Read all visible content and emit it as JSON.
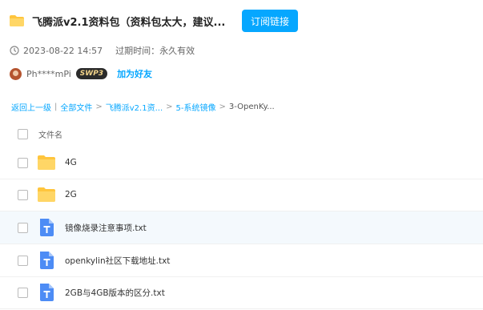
{
  "header": {
    "title": "飞腾派v2.1资料包（资料包太大，建议...",
    "subscribe_label": "订阅链接"
  },
  "meta": {
    "datetime": "2023-08-22 14:57",
    "expire": "过期时间：永久有效"
  },
  "user": {
    "name": "Ph****mPi",
    "badge": "SWP3",
    "add_friend": "加为好友"
  },
  "breadcrumb": {
    "back": "返回上一级",
    "all_files": "全部文件",
    "level1": "飞腾派v2.1资...",
    "level2": "5-系统镜像",
    "current": "3-OpenKy...",
    "sep": ">",
    "divider": "|"
  },
  "list": {
    "header": "文件名",
    "rows": [
      {
        "name": "4G",
        "icon": "folder-icon"
      },
      {
        "name": "2G",
        "icon": "folder-icon"
      },
      {
        "name": "镜像烧录注意事项.txt",
        "icon": "txt-file-icon"
      },
      {
        "name": "openkylin社区下载地址.txt",
        "icon": "txt-file-icon"
      },
      {
        "name": "2GB与4GB版本的区分.txt",
        "icon": "txt-file-icon"
      }
    ]
  },
  "colors": {
    "accent": "#06a7ff",
    "folder": "#ffc53d",
    "txt_icon": "#4d8cf5",
    "row_highlight": "#f4f9fd"
  }
}
